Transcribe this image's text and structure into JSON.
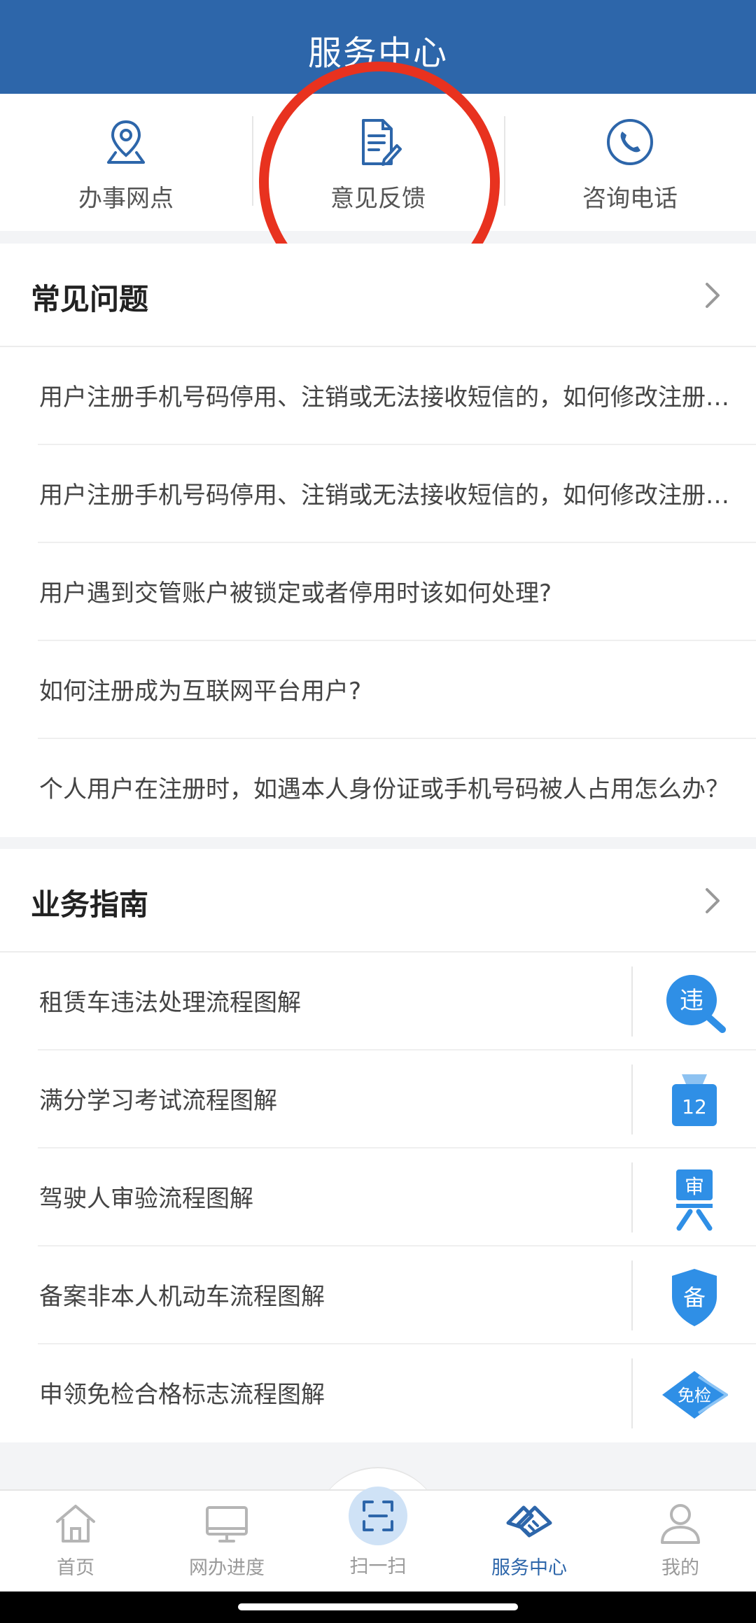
{
  "header": {
    "title": "服务中心"
  },
  "quick_actions": [
    {
      "label": "办事网点",
      "icon": "location-pin-icon"
    },
    {
      "label": "意见反馈",
      "icon": "feedback-document-icon"
    },
    {
      "label": "咨询电话",
      "icon": "phone-icon"
    }
  ],
  "faq": {
    "title": "常见问题",
    "items": [
      "用户注册手机号码停用、注销或无法接收短信的，如何修改注册手机号码？",
      "用户注册手机号码停用、注销或无法接收短信的，如何修改注册手机号码？",
      "用户遇到交管账户被锁定或者停用时该如何处理?",
      "如何注册成为互联网平台用户?",
      "个人用户在注册时，如遇本人身份证或手机号码被人占用怎么办？"
    ]
  },
  "guide": {
    "title": "业务指南",
    "items": [
      {
        "label": "租赁车违法处理流程图解",
        "icon": "violation-search-icon",
        "icon_text": "违"
      },
      {
        "label": "满分学习考试流程图解",
        "icon": "score-12-icon",
        "icon_text": "12"
      },
      {
        "label": "驾驶人审验流程图解",
        "icon": "review-icon",
        "icon_text": "审"
      },
      {
        "label": "备案非本人机动车流程图解",
        "icon": "record-shield-icon",
        "icon_text": "备"
      },
      {
        "label": "申领免检合格标志流程图解",
        "icon": "exempt-diamond-icon",
        "icon_text": "免检"
      }
    ]
  },
  "tabs": [
    {
      "label": "首页",
      "icon": "home-icon",
      "active": false
    },
    {
      "label": "网办进度",
      "icon": "monitor-icon",
      "active": false
    },
    {
      "label": "扫一扫",
      "icon": "scan-icon",
      "active": false
    },
    {
      "label": "服务中心",
      "icon": "handshake-icon",
      "active": true
    },
    {
      "label": "我的",
      "icon": "user-icon",
      "active": false
    }
  ],
  "colors": {
    "brand": "#2d66aa",
    "highlight": "#e8321f",
    "icon_blue": "#2f8fe6"
  }
}
